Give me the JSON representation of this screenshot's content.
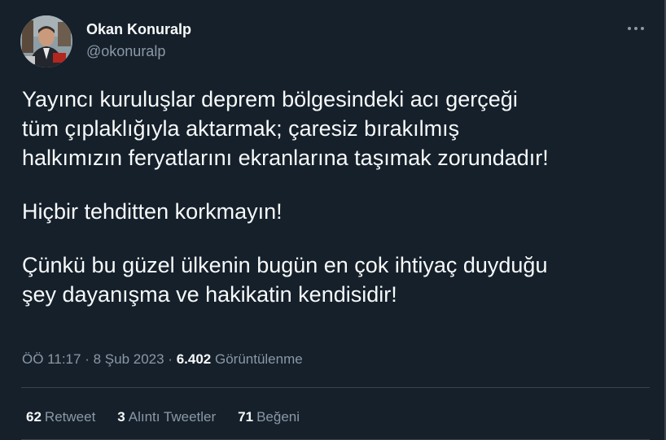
{
  "author": {
    "display_name": "Okan Konuralp",
    "handle": "@okonuralp"
  },
  "tweet": {
    "paragraphs": [
      "Yayıncı kuruluşlar deprem bölgesindeki acı gerçeği\ntüm çıplaklığıyla aktarmak; çaresiz bırakılmış\nhalkımızın feryatlarını ekranlarına taşımak zorundadır!",
      "Hiçbir tehditten korkmayın!",
      "Çünkü bu güzel ülkenin bugün en çok ihtiyaç duyduğu\nşey dayanışma ve hakikatin kendisidir!"
    ]
  },
  "meta": {
    "time": "ÖÖ 11:17",
    "separator": "·",
    "date": "8 Şub 2023",
    "views_count": "6.402",
    "views_label": "Görüntülenme"
  },
  "stats": {
    "retweets": {
      "count": "62",
      "label": "Retweet"
    },
    "quotes": {
      "count": "3",
      "label": "Alıntı Tweetler"
    },
    "likes": {
      "count": "71",
      "label": "Beğeni"
    }
  },
  "icons": {
    "more": "more-horizontal-icon"
  },
  "colors": {
    "background": "#15202b",
    "text_primary": "#f7f9f9",
    "text_secondary": "#8b98a5",
    "border": "#38444d"
  }
}
